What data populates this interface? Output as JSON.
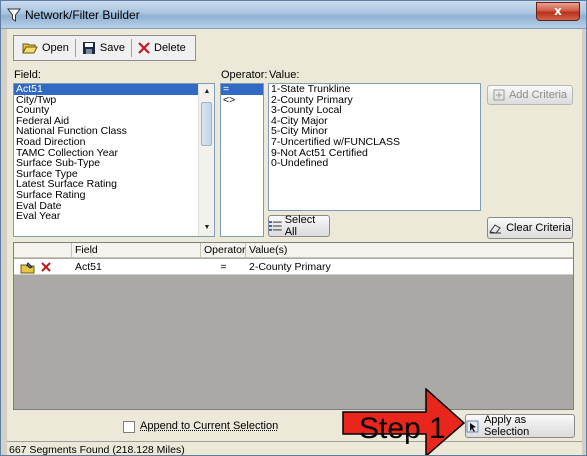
{
  "window": {
    "title": "Network/Filter Builder",
    "close_glyph": "x"
  },
  "toolbar": {
    "open_label": "Open",
    "save_label": "Save",
    "delete_label": "Delete"
  },
  "field": {
    "label": "Field:",
    "items": [
      "Act51",
      "City/Twp",
      "County",
      "Federal Aid",
      "National Function Class",
      "Road Direction",
      "TAMC Collection Year",
      "Surface Sub-Type",
      "Surface Type",
      "Latest Surface Rating",
      "Surface Rating",
      "Eval Date",
      "Eval Year"
    ],
    "selected": "Act51"
  },
  "operator": {
    "label": "Operator:",
    "items": [
      "=",
      "<>"
    ],
    "selected": "="
  },
  "value": {
    "label": "Value:",
    "items": [
      "1-State Trunkline",
      "2-County Primary",
      "3-County Local",
      "4-City Major",
      "5-City Minor",
      "7-Uncertified w/FUNCLASS",
      "9-Not Act51 Certified",
      "0-Undefined"
    ]
  },
  "buttons": {
    "add_criteria": "Add Criteria",
    "select_all": "Select All",
    "clear_criteria": "Clear Criteria",
    "apply_selection": "Apply as Selection"
  },
  "criteria_grid": {
    "columns": [
      "Field",
      "Operator",
      "Value(s)"
    ],
    "rows": [
      {
        "field": "Act51",
        "operator": "=",
        "values": "2-County Primary"
      }
    ]
  },
  "append_label": "Append to Current Selection",
  "append_checked": false,
  "status": "667 Segments Found (218.128 Miles)",
  "annotation": {
    "text": "Step 1",
    "color": "#e8261c"
  },
  "colors": {
    "selection": "#316ac5",
    "close": "#c8442c",
    "grid_bg": "#aba9a5"
  }
}
